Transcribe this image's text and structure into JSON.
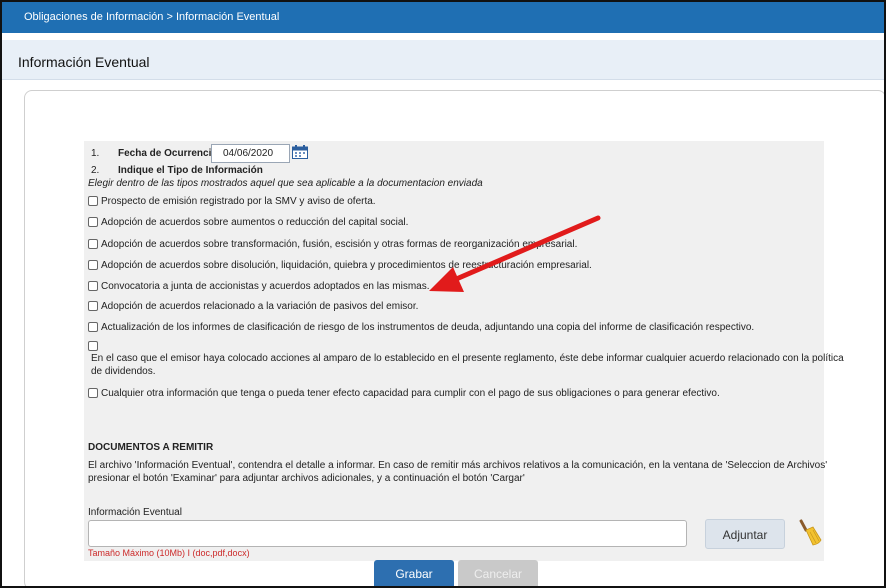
{
  "breadcrumb": "Obligaciones de Información > Información Eventual",
  "page_title": "Información Eventual",
  "fecha": {
    "number": "1.",
    "label": "Fecha de Ocurrencia",
    "value": "04/06/2020"
  },
  "tipo": {
    "number": "2.",
    "label": "Indique el Tipo de Información",
    "instructions": "Elegir dentro de las tipos mostrados aquel que sea aplicable a la documentacion enviada"
  },
  "options": [
    "Prospecto de emisión registrado por la SMV y aviso de oferta.",
    "Adopción de acuerdos sobre aumentos o reducción del capital social.",
    "Adopción de acuerdos sobre transformación, fusión, escisión y otras formas de reorganización empresarial.",
    "Adopción de acuerdos sobre disolución, liquidación, quiebra y procedimientos de reestructuración empresarial.",
    "Convocatoria a junta de accionistas y acuerdos adoptados en las mismas.",
    "Adopción de acuerdos relacionado a la variación de pasivos del emisor.",
    "Actualización de los informes de clasificación de riesgo de los instrumentos de deuda, adjuntando una copia del informe de clasificación respectivo.",
    "En el caso que el emisor haya colocado acciones al amparo de lo establecido en el presente reglamento, éste debe informar cualquier acuerdo relacionado con la política",
    "de dividendos.",
    "Cualquier otra información que tenga o pueda tener efecto capacidad para cumplir con el pago de sus obligaciones o para generar efectivo."
  ],
  "documentos": {
    "heading": "DOCUMENTOS A REMITIR",
    "text_line1": "El archivo 'Información Eventual', contendra el detalle a informar. En caso de remitir más archivos relativos a la comunicación, en la ventana de 'Seleccion de Archivos'",
    "text_line2": "presionar el botón 'Examinar' para adjuntar archivos adicionales, y a continuación el botón 'Cargar'"
  },
  "upload": {
    "label": "Información Eventual",
    "value": "",
    "attach_label": "Adjuntar",
    "hint": "Tamaño Máximo (10Mb) I (doc,pdf,docx)"
  },
  "actions": {
    "save_label": "Grabar",
    "cancel_label": "Cancelar"
  },
  "colors": {
    "header_blue": "#1f6fb3",
    "annotation_arrow": "#e11b1b",
    "hint_red": "#cc2a2a"
  },
  "icons": [
    "calendar-icon",
    "broom-icon"
  ]
}
